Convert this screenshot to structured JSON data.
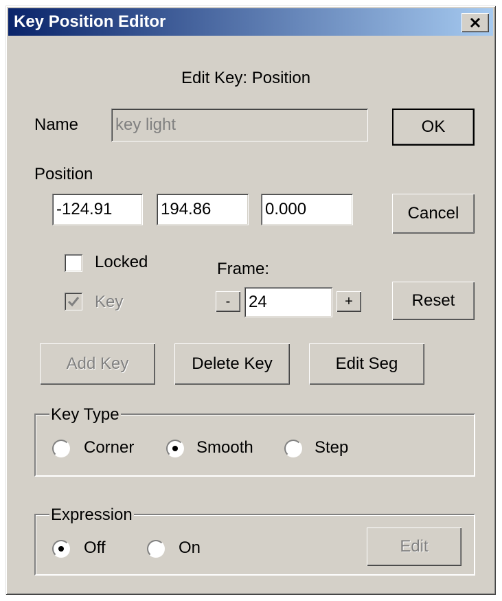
{
  "window": {
    "title": "Key Position Editor"
  },
  "header": {
    "edit_key": "Edit Key: Position"
  },
  "name": {
    "label": "Name",
    "value": "key light"
  },
  "buttons": {
    "ok": "OK",
    "cancel": "Cancel",
    "reset": "Reset",
    "add_key": "Add Key",
    "delete_key": "Delete Key",
    "edit_seg": "Edit Seg",
    "edit": "Edit"
  },
  "position": {
    "label": "Position",
    "x": "-124.91",
    "y": "194.86",
    "z": "0.000"
  },
  "locked": {
    "label": "Locked",
    "checked": false
  },
  "key": {
    "label": "Key",
    "checked": true
  },
  "frame": {
    "label": "Frame:",
    "value": "24",
    "minus": "-",
    "plus": "+"
  },
  "key_type": {
    "title": "Key Type",
    "options": [
      "Corner",
      "Smooth",
      "Step"
    ],
    "selected": "Smooth"
  },
  "expression": {
    "title": "Expression",
    "options": [
      "Off",
      "On"
    ],
    "selected": "Off"
  },
  "icons": {
    "close": "close-icon",
    "check": "checkmark-icon"
  }
}
